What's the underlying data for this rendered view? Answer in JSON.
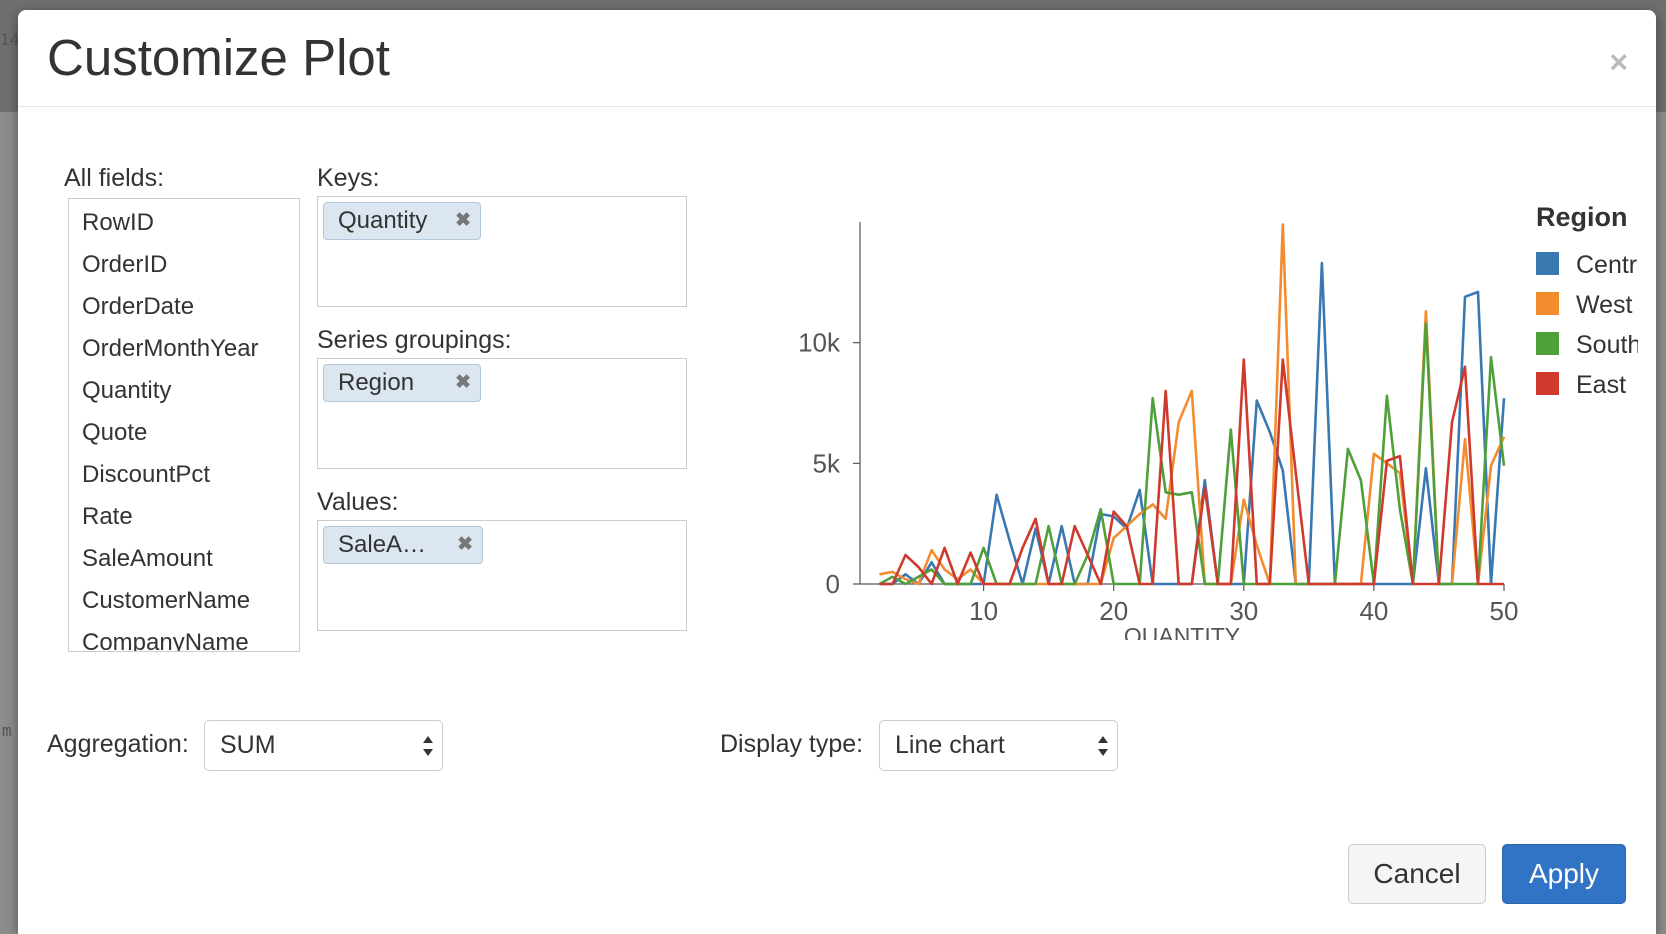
{
  "dialog": {
    "title": "Customize Plot",
    "close_icon": "close-icon"
  },
  "background": {
    "fragment_top": "14",
    "fragment_mid": "m"
  },
  "fields": {
    "label": "All fields:",
    "items": [
      "RowID",
      "OrderID",
      "OrderDate",
      "OrderMonthYear",
      "Quantity",
      "Quote",
      "DiscountPct",
      "Rate",
      "SaleAmount",
      "CustomerName",
      "CompanyName"
    ]
  },
  "keys": {
    "label": "Keys:",
    "chips": [
      "Quantity"
    ]
  },
  "series_groupings": {
    "label": "Series groupings:",
    "chips": [
      "Region"
    ]
  },
  "values": {
    "label": "Values:",
    "chips": [
      "SaleA…"
    ]
  },
  "aggregation": {
    "label": "Aggregation:",
    "selected": "SUM"
  },
  "display_type": {
    "label": "Display type:",
    "selected": "Line chart"
  },
  "buttons": {
    "cancel": "Cancel",
    "apply": "Apply"
  },
  "chart_data": {
    "type": "line",
    "xlabel": "QUANTITY",
    "ylabel": "",
    "xlim": [
      0.5,
      50
    ],
    "ylim": [
      0,
      15000
    ],
    "x_ticks": [
      10,
      20,
      30,
      40,
      50
    ],
    "y_ticks": [
      0,
      5000,
      10000
    ],
    "y_tick_labels": [
      "0",
      "5k",
      "10k"
    ],
    "legend_title": "Region",
    "legend_position": "right",
    "x": [
      2,
      3,
      4,
      5,
      6,
      7,
      8,
      9,
      10,
      11,
      12,
      13,
      14,
      15,
      16,
      17,
      18,
      19,
      20,
      21,
      22,
      23,
      24,
      25,
      26,
      27,
      28,
      29,
      30,
      31,
      32,
      33,
      34,
      35,
      36,
      37,
      38,
      39,
      40,
      41,
      42,
      43,
      44,
      45,
      46,
      47,
      48,
      49,
      50
    ],
    "series": [
      {
        "name": "Central",
        "color": "#3a78b2",
        "values": [
          0,
          0,
          400,
          0,
          900,
          0,
          0,
          0,
          0,
          3700,
          1800,
          0,
          2300,
          0,
          2400,
          0,
          0,
          2900,
          2800,
          2300,
          3900,
          0,
          0,
          0,
          0,
          4300,
          0,
          0,
          0,
          7600,
          6300,
          4700,
          0,
          0,
          13300,
          0,
          0,
          0,
          0,
          0,
          0,
          0,
          4800,
          0,
          0,
          11900,
          12100,
          0,
          7700
        ]
      },
      {
        "name": "West",
        "color": "#f28c2f",
        "values": [
          400,
          500,
          200,
          0,
          1400,
          600,
          200,
          600,
          0,
          0,
          0,
          0,
          0,
          0,
          0,
          0,
          0,
          0,
          1900,
          2400,
          2900,
          3300,
          2700,
          6700,
          8000,
          0,
          0,
          0,
          3500,
          1600,
          0,
          14900,
          0,
          0,
          0,
          0,
          0,
          0,
          5400,
          5000,
          4600,
          0,
          11300,
          0,
          0,
          6000,
          0,
          4900,
          6100
        ]
      },
      {
        "name": "South",
        "color": "#4f9f3b",
        "values": [
          0,
          300,
          0,
          300,
          600,
          0,
          0,
          0,
          1500,
          0,
          0,
          0,
          0,
          2400,
          0,
          0,
          1200,
          3100,
          0,
          0,
          0,
          7700,
          3800,
          3700,
          3800,
          0,
          0,
          6400,
          0,
          0,
          0,
          0,
          0,
          0,
          0,
          0,
          5600,
          4300,
          0,
          7800,
          3100,
          0,
          10800,
          0,
          0,
          0,
          0,
          9400,
          4900
        ]
      },
      {
        "name": "East",
        "color": "#cf3a2e",
        "values": [
          0,
          0,
          1200,
          700,
          0,
          1500,
          0,
          1300,
          0,
          0,
          0,
          1500,
          2700,
          0,
          0,
          2400,
          1200,
          0,
          3000,
          2400,
          0,
          0,
          8000,
          0,
          0,
          4000,
          0,
          0,
          9300,
          0,
          0,
          9300,
          4600,
          0,
          0,
          0,
          0,
          0,
          0,
          5100,
          5300,
          0,
          0,
          0,
          6700,
          9000,
          0,
          0,
          0
        ]
      }
    ]
  }
}
